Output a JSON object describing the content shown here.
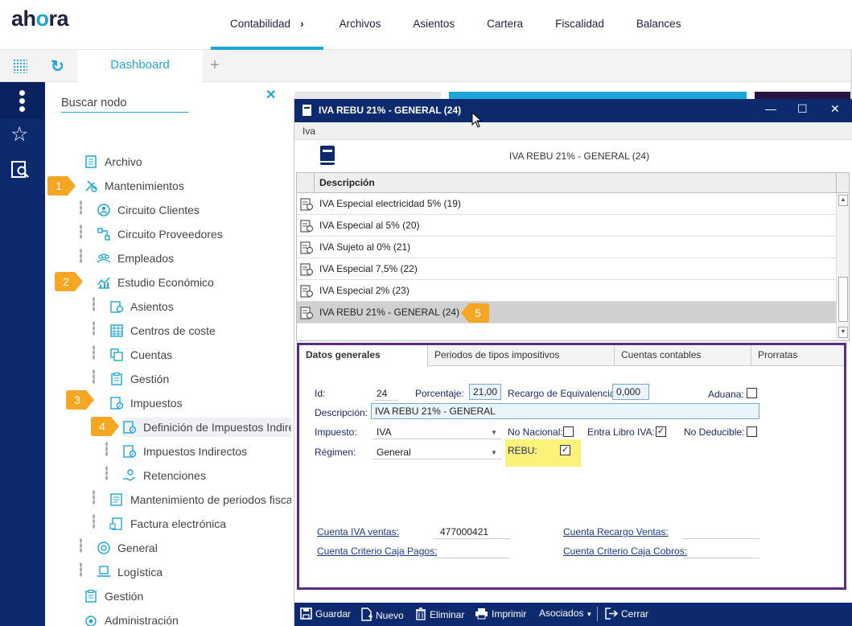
{
  "brand": {
    "name_prefix": "ah",
    "name_o": "o",
    "name_suffix": "ra"
  },
  "topnav": [
    "Contabilidad",
    "Archivos",
    "Asientos",
    "Cartera",
    "Fiscalidad",
    "Balances"
  ],
  "tabsbar": {
    "active_tab": "Dashboard",
    "add": "+"
  },
  "tree": {
    "search_placeholder": "Buscar nodo",
    "nodes": {
      "archivo": "Archivo",
      "mantenimientos": "Mantenimientos",
      "circuito_clientes": "Circuito Clientes",
      "circuito_proveedores": "Circuito Proveedores",
      "empleados": "Empleados",
      "estudio_economico": "Estudio Económico",
      "asientos": "Asientos",
      "centros_coste": "Centros de coste",
      "cuentas": "Cuentas",
      "gestion_sub": "Gestión",
      "impuestos": "Impuestos",
      "definicion": "Definición de Impuestos Indire",
      "impuestos_indirectos": "Impuestos Indirectos",
      "retenciones": "Retenciones",
      "mant_periodos": "Mantenimiento de periodos fisca",
      "factura_electronica": "Factura electrónica",
      "general": "General",
      "logistica": "Logística",
      "gestion": "Gestión",
      "administracion": "Administración"
    },
    "badges": [
      "1",
      "2",
      "3",
      "4",
      "5"
    ]
  },
  "modal": {
    "title": "IVA REBU 21% - GENERAL (24)",
    "menu": "Iva",
    "header_text": "IVA REBU 21% - GENERAL (24)",
    "grid_header": "Descripción",
    "rows": [
      "IVA Especial electricidad 5% (19)",
      "IVA Especial al 5% (20)",
      "IVA Sujeto al 0% (21)",
      "IVA Especial 7,5% (22)",
      "IVA Especial 2% (23)",
      "IVA REBU 21% - GENERAL (24)"
    ],
    "tabs": [
      "Datos generales",
      "Periodos de tipos impositivos",
      "Cuentas contables",
      "Prorratas"
    ],
    "form": {
      "id_label": "Id:",
      "id_value": "24",
      "porcentaje_label": "Porcentaje:",
      "porcentaje_value": "21,00",
      "recargo_label": "Recargo de Equivalencia:",
      "recargo_value": "0,000",
      "aduana_label": "Aduana:",
      "descripcion_label": "Descripción:",
      "descripcion_value": "IVA REBU 21% - GENERAL",
      "impuesto_label": "Impuesto:",
      "impuesto_value": "IVA",
      "no_nacional_label": "No Nacional:",
      "entra_libro_label": "Entra Libro IVA:",
      "no_deducible_label": "No Deducible:",
      "regimen_label": "Régimen:",
      "regimen_value": "General",
      "rebu_label": "REBU:",
      "cuenta_iva_ventas_label": "Cuenta IVA ventas:",
      "cuenta_iva_ventas_value": "477000421",
      "cuenta_recargo_label": "Cuenta Recargo Ventas:",
      "cuenta_criterio_pagos_label": "Cuenta Criterio Caja Pagos:",
      "cuenta_criterio_cobros_label": "Cuenta Criterio Caja Cobros:",
      "check_mark": "✓"
    },
    "toolbar": {
      "guardar": "Guardar",
      "nuevo": "Nuevo",
      "eliminar": "Eliminar",
      "imprimir": "Imprimir",
      "asociados": "Asociados",
      "cerrar": "Cerrar"
    }
  }
}
